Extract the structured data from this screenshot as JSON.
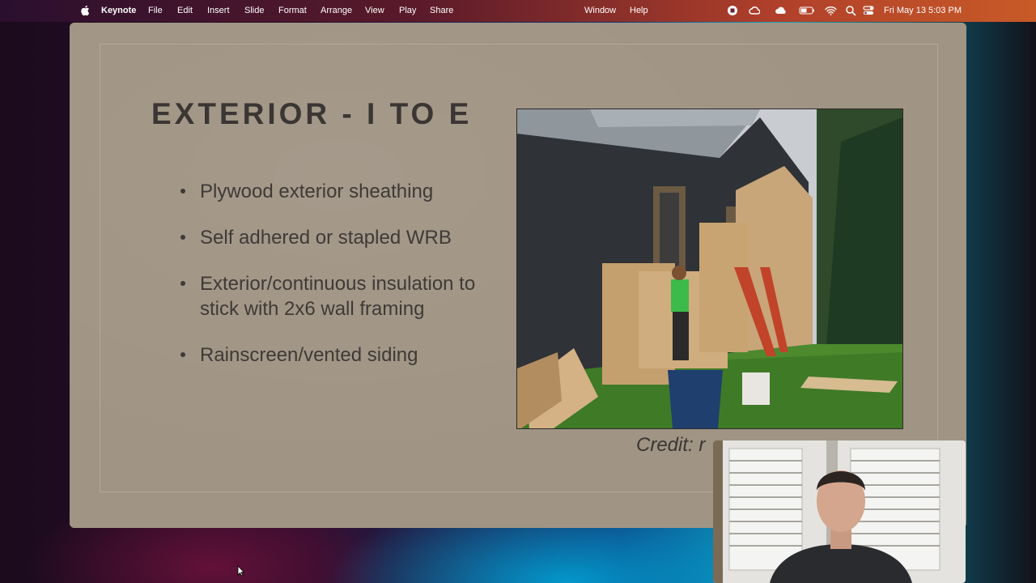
{
  "menubar": {
    "app_name": "Keynote",
    "menus": [
      "File",
      "Edit",
      "Insert",
      "Slide",
      "Format",
      "Arrange",
      "View",
      "Play",
      "Share"
    ],
    "window_menu": "Window",
    "help_menu": "Help",
    "clock": "Fri May 13  5:03 PM",
    "status_icons": [
      "record-icon",
      "creative-cloud-icon",
      "weather-icon",
      "battery-icon",
      "wifi-icon",
      "search-icon",
      "control-center-icon"
    ]
  },
  "slide": {
    "title": "EXTERIOR - I TO E",
    "bullets": [
      "Plywood exterior sheathing",
      "Self adhered or stapled WRB",
      "Exterior/continuous insulation to stick with 2x6 wall framing",
      "Rainscreen/vented siding"
    ],
    "credit": "Credit: r"
  },
  "colors": {
    "slide_background": "#a09484",
    "title_text": "#3b3633",
    "body_text": "#3f3a37"
  }
}
